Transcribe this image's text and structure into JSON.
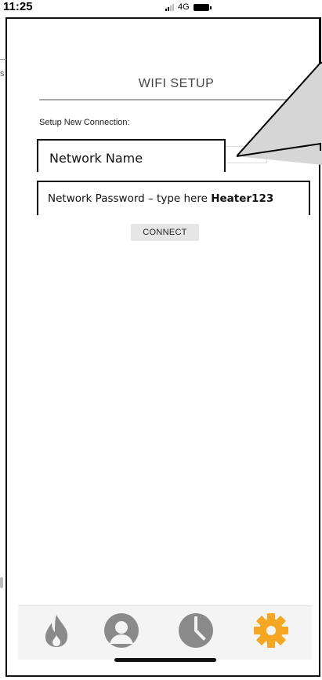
{
  "status_bar": {
    "time": "11:25",
    "network": "4G"
  },
  "background_fragment": {
    "partial_text": "s"
  },
  "screen": {
    "title": "WIFI SETUP",
    "subheading": "Setup New Connection:"
  },
  "form": {
    "network_name_label": "Network Name",
    "password_label_prefix": "Network Password – type here ",
    "password_value": "Heater123",
    "connect_label": "CONNECT"
  },
  "tabbar": {
    "items": [
      {
        "icon": "flame-icon",
        "color": "#8a8a8a"
      },
      {
        "icon": "user-icon",
        "color": "#8a8a8a"
      },
      {
        "icon": "clock-icon",
        "color": "#8a8a8a"
      },
      {
        "icon": "gear-icon",
        "color": "#f5a623",
        "active": true
      }
    ]
  },
  "colors": {
    "accent": "#f5a623",
    "inactive_icon": "#8a8a8a",
    "callout_fill": "#d4d4d4"
  }
}
